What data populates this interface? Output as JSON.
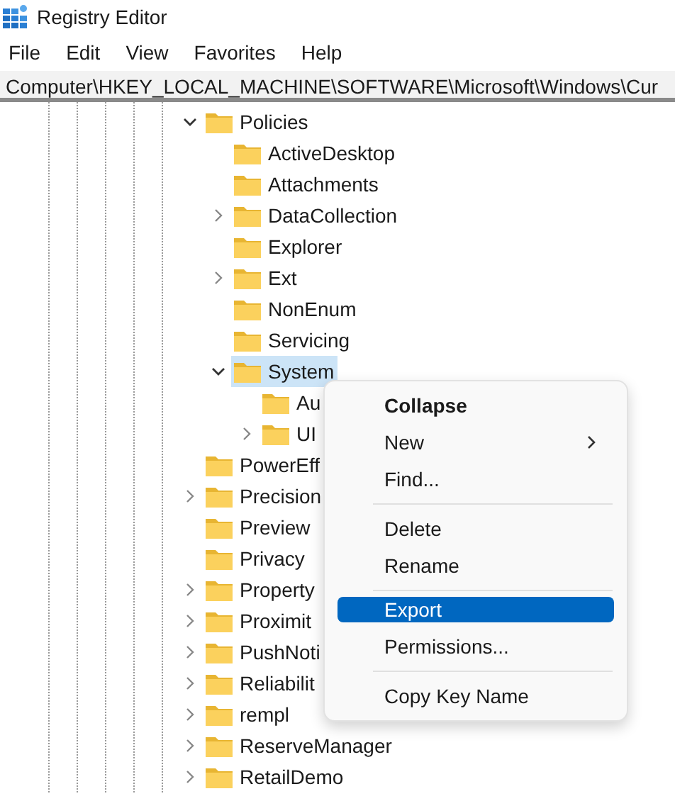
{
  "window": {
    "title": "Registry Editor"
  },
  "menu_bar": [
    "File",
    "Edit",
    "View",
    "Favorites",
    "Help"
  ],
  "address": "Computer\\HKEY_LOCAL_MACHINE\\SOFTWARE\\Microsoft\\Windows\\Cur",
  "tree": [
    {
      "label": "Policies",
      "kind": "branch",
      "expanded": true,
      "selected": false,
      "children": [
        {
          "label": "ActiveDesktop",
          "kind": "leaf",
          "selected": false
        },
        {
          "label": "Attachments",
          "kind": "leaf",
          "selected": false
        },
        {
          "label": "DataCollection",
          "kind": "branch",
          "expanded": false,
          "selected": false
        },
        {
          "label": "Explorer",
          "kind": "leaf",
          "selected": false
        },
        {
          "label": "Ext",
          "kind": "branch",
          "expanded": false,
          "selected": false
        },
        {
          "label": "NonEnum",
          "kind": "leaf",
          "selected": false
        },
        {
          "label": "Servicing",
          "kind": "leaf",
          "selected": false
        },
        {
          "label": "System",
          "kind": "branch",
          "expanded": true,
          "selected": true,
          "children": [
            {
              "label": "Au",
              "kind": "leaf",
              "selected": false
            },
            {
              "label": "UI",
              "kind": "branch",
              "expanded": false,
              "selected": false
            }
          ]
        }
      ]
    },
    {
      "label": "PowerEff",
      "kind": "leaf",
      "selected": false
    },
    {
      "label": "Precision",
      "kind": "branch",
      "expanded": false,
      "selected": false
    },
    {
      "label": "Preview",
      "kind": "leaf",
      "selected": false
    },
    {
      "label": "Privacy",
      "kind": "leaf",
      "selected": false
    },
    {
      "label": "Property",
      "kind": "branch",
      "expanded": false,
      "selected": false
    },
    {
      "label": "Proximit",
      "kind": "branch",
      "expanded": false,
      "selected": false
    },
    {
      "label": "PushNoti",
      "kind": "branch",
      "expanded": false,
      "selected": false
    },
    {
      "label": "Reliabilit",
      "kind": "branch",
      "expanded": false,
      "selected": false
    },
    {
      "label": "rempl",
      "kind": "branch",
      "expanded": false,
      "selected": false
    },
    {
      "label": "ReserveManager",
      "kind": "branch",
      "expanded": false,
      "selected": false
    },
    {
      "label": "RetailDemo",
      "kind": "branch",
      "expanded": false,
      "selected": false
    }
  ],
  "context_menu": {
    "groups": [
      [
        {
          "label": "Collapse",
          "default": true,
          "submenu": false,
          "selected": false
        },
        {
          "label": "New",
          "default": false,
          "submenu": true,
          "selected": false
        },
        {
          "label": "Find...",
          "default": false,
          "submenu": false,
          "selected": false
        }
      ],
      [
        {
          "label": "Delete",
          "default": false,
          "submenu": false,
          "selected": false
        },
        {
          "label": "Rename",
          "default": false,
          "submenu": false,
          "selected": false
        }
      ],
      [
        {
          "label": "Export",
          "default": false,
          "submenu": false,
          "selected": true
        },
        {
          "label": "Permissions...",
          "default": false,
          "submenu": false,
          "selected": false
        }
      ],
      [
        {
          "label": "Copy Key Name",
          "default": false,
          "submenu": false,
          "selected": false
        }
      ]
    ]
  }
}
